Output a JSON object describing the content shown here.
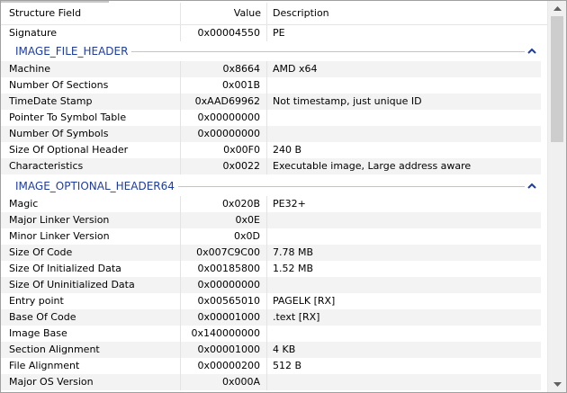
{
  "columns": {
    "field": "Structure Field",
    "value": "Value",
    "description": "Description"
  },
  "signature": {
    "field": "Signature",
    "value": "0x00004550",
    "description": "PE"
  },
  "file_header": {
    "title": "IMAGE_FILE_HEADER",
    "rows": [
      {
        "field": "Machine",
        "value": "0x8664",
        "description": "AMD x64"
      },
      {
        "field": "Number Of Sections",
        "value": "0x001B",
        "description": ""
      },
      {
        "field": "TimeDate Stamp",
        "value": "0xAAD69962",
        "description": "Not timestamp, just unique ID"
      },
      {
        "field": "Pointer To Symbol Table",
        "value": "0x00000000",
        "description": ""
      },
      {
        "field": "Number Of Symbols",
        "value": "0x00000000",
        "description": ""
      },
      {
        "field": "Size Of Optional Header",
        "value": "0x00F0",
        "description": "240 B"
      },
      {
        "field": "Characteristics",
        "value": "0x0022",
        "description": "Executable image, Large address aware"
      }
    ]
  },
  "optional_header": {
    "title": "IMAGE_OPTIONAL_HEADER64",
    "rows": [
      {
        "field": "Magic",
        "value": "0x020B",
        "description": "PE32+"
      },
      {
        "field": "Major Linker Version",
        "value": "0x0E",
        "description": ""
      },
      {
        "field": "Minor Linker Version",
        "value": "0x0D",
        "description": ""
      },
      {
        "field": "Size Of Code",
        "value": "0x007C9C00",
        "description": "7.78 MB"
      },
      {
        "field": "Size Of Initialized Data",
        "value": "0x00185800",
        "description": "1.52 MB"
      },
      {
        "field": "Size Of Uninitialized Data",
        "value": "0x00000000",
        "description": ""
      },
      {
        "field": "Entry point",
        "value": "0x00565010",
        "description": "PAGELK [RX]"
      },
      {
        "field": "Base Of Code",
        "value": "0x00001000",
        "description": ".text [RX]"
      },
      {
        "field": "Image Base",
        "value": "0x140000000",
        "description": ""
      },
      {
        "field": "Section Alignment",
        "value": "0x00001000",
        "description": "4 KB"
      },
      {
        "field": "File Alignment",
        "value": "0x00000200",
        "description": "512 B"
      },
      {
        "field": "Major OS Version",
        "value": "0x000A",
        "description": ""
      }
    ]
  },
  "icons": {
    "collapse": "chevron-up-icon",
    "scroll_up": "arrow-up-icon",
    "scroll_down": "arrow-down-icon"
  },
  "colors": {
    "group_title": "#1e3c9c",
    "group_line": "#b6c5e6",
    "alt_row": "#f3f3f3",
    "scrollbar_thumb": "#cdcdcd"
  }
}
